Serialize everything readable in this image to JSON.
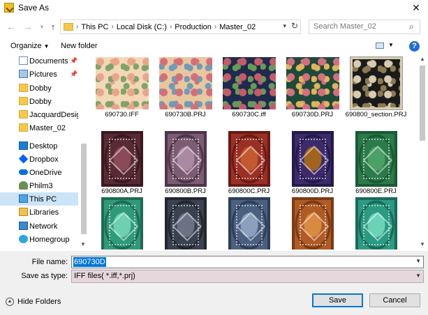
{
  "window": {
    "title": "Save As",
    "close_glyph": "✕"
  },
  "navigation": {
    "back": "←",
    "forward": "→",
    "up": "↑",
    "breadcrumbs": [
      "This PC",
      "Local Disk (C:)",
      "Production",
      "Master_02"
    ],
    "search_placeholder": "Search Master_02"
  },
  "toolbar": {
    "organize": "Organize",
    "new_folder": "New folder",
    "help": "?"
  },
  "sidebar": {
    "items": [
      {
        "label": "Documents",
        "icon": "documents-icon",
        "pinned": true
      },
      {
        "label": "Pictures",
        "icon": "pictures-icon",
        "pinned": true
      },
      {
        "label": "Dobby",
        "icon": "folder-icon"
      },
      {
        "label": "Dobby",
        "icon": "folder-icon"
      },
      {
        "label": "JacquardDesigne",
        "icon": "folder-icon"
      },
      {
        "label": "Master_02",
        "icon": "folder-icon"
      },
      {
        "label": "Desktop",
        "icon": "desktop-icon"
      },
      {
        "label": "Dropbox",
        "icon": "dropbox-icon"
      },
      {
        "label": "OneDrive",
        "icon": "onedrive-icon"
      },
      {
        "label": "Philm3",
        "icon": "user-icon"
      },
      {
        "label": "This PC",
        "icon": "this-pc-icon",
        "selected": true
      },
      {
        "label": "Libraries",
        "icon": "libraries-icon"
      },
      {
        "label": "Network",
        "icon": "network-icon"
      },
      {
        "label": "Homegroup",
        "icon": "homegroup-icon"
      }
    ]
  },
  "files": [
    {
      "name": "690730.IFF",
      "kind": "fabric",
      "colors": [
        "#f3d7b6",
        "#e9a58a",
        "#7fa46a"
      ]
    },
    {
      "name": "690730B.PRJ",
      "kind": "fabric",
      "colors": [
        "#e8c79e",
        "#d46f7a",
        "#6f9bb9"
      ]
    },
    {
      "name": "690730C.iff",
      "kind": "fabric",
      "colors": [
        "#1e2b4c",
        "#c85a6a",
        "#6a9a5a"
      ]
    },
    {
      "name": "690730D.PRJ",
      "kind": "fabric",
      "colors": [
        "#1d4a3a",
        "#d46f82",
        "#e0b45a"
      ]
    },
    {
      "name": "690800_section.PRJ",
      "kind": "fabric",
      "colors": [
        "#1a1a1a",
        "#d8cbb0",
        "#8a7a50"
      ]
    },
    {
      "name": "690800A.PRJ",
      "kind": "rug",
      "colors": [
        "#5a2a34",
        "#8a4a58",
        "#3a1a22"
      ]
    },
    {
      "name": "690800B.PRJ",
      "kind": "rug",
      "colors": [
        "#7c5c72",
        "#a98aa2",
        "#4e3548"
      ]
    },
    {
      "name": "690800C.PRJ",
      "kind": "rug",
      "colors": [
        "#9a3024",
        "#c4582e",
        "#6a1a14"
      ]
    },
    {
      "name": "690800D.PRJ",
      "kind": "rug",
      "colors": [
        "#3c2a6a",
        "#a0641e",
        "#241a4a"
      ]
    },
    {
      "name": "690800E.PRJ",
      "kind": "rug",
      "colors": [
        "#2a7a4a",
        "#4aa066",
        "#1a5a34"
      ]
    },
    {
      "name": "",
      "kind": "rug",
      "colors": [
        "#2f9a7a",
        "#6ed0b0",
        "#1f6a54"
      ]
    },
    {
      "name": "",
      "kind": "rug",
      "colors": [
        "#3a4250",
        "#6a7284",
        "#22262e"
      ]
    },
    {
      "name": "",
      "kind": "rug",
      "colors": [
        "#4a6080",
        "#8aa0bc",
        "#2e3e56"
      ]
    },
    {
      "name": "",
      "kind": "rug",
      "colors": [
        "#b05a24",
        "#d88a40",
        "#7a3a14"
      ]
    },
    {
      "name": "",
      "kind": "rug",
      "colors": [
        "#2a9a82",
        "#6ad2b6",
        "#1a6a58"
      ]
    }
  ],
  "form": {
    "file_name_label": "File name:",
    "file_name_value": "690730D",
    "save_type_label": "Save as type:",
    "save_type_value": "IFF files( *.iff,*.prj)"
  },
  "footer": {
    "hide_folders": "Hide Folders",
    "save": "Save",
    "cancel": "Cancel"
  }
}
